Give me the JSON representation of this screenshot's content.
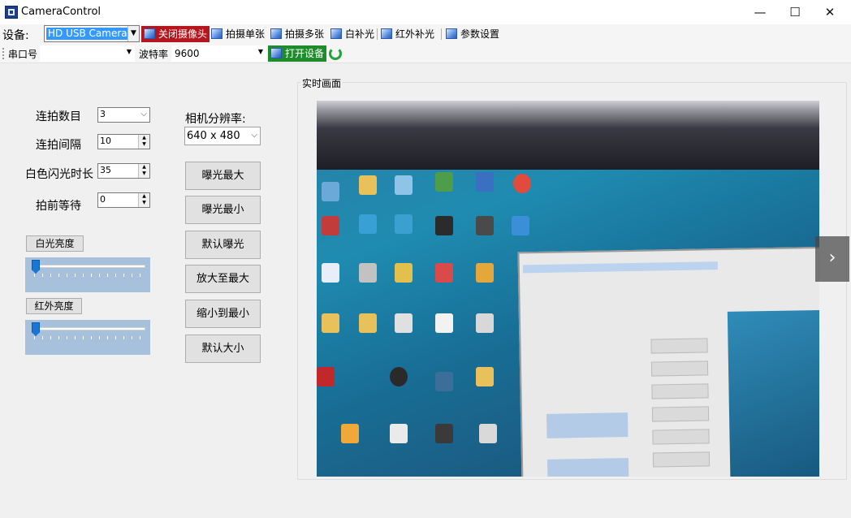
{
  "window": {
    "title": "CameraControl",
    "minimize": "—",
    "maximize": "☐",
    "close": "✕"
  },
  "menu": {
    "device_label": "设备:",
    "device_value": "HD USB Camera",
    "close_camera": "关闭摄像头",
    "capture_single": "拍摄单张",
    "capture_multi": "拍摄多张",
    "white_light": "白补光",
    "ir_light": "红外补光",
    "settings": "参数设置"
  },
  "serial": {
    "port_label": "串口号",
    "port_value": "",
    "baud_label": "波特率",
    "baud_value": "9600",
    "open_device": "打开设备"
  },
  "settings": {
    "burst_count_label": "连拍数目",
    "burst_count_value": "3",
    "burst_interval_label": "连拍间隔",
    "burst_interval_value": "10",
    "white_flash_label": "白色闪光时长",
    "white_flash_value": "35",
    "pre_wait_label": "拍前等待",
    "pre_wait_value": "0",
    "white_brightness_label": "白光亮度",
    "ir_brightness_label": "红外亮度",
    "white_brightness_level": 0.0,
    "ir_brightness_level": 0.0
  },
  "camera": {
    "resolution_label": "相机分辨率:",
    "resolution_value": "640 x 480"
  },
  "actions": {
    "exposure_max": "曝光最大",
    "exposure_min": "曝光最小",
    "exposure_default": "默认曝光",
    "zoom_max": "放大至最大",
    "zoom_min": "缩小到最小",
    "size_default": "默认大小"
  },
  "preview": {
    "title": "实时画面",
    "next_label": "›"
  }
}
